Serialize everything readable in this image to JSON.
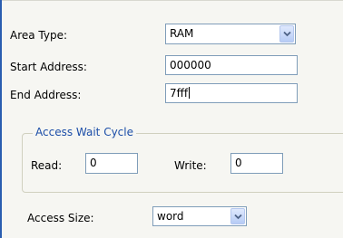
{
  "form": {
    "area_type": {
      "label": "Area Type:",
      "value": "RAM"
    },
    "start_address": {
      "label": "Start Address:",
      "value": "000000"
    },
    "end_address": {
      "label": "End Address:",
      "value": "7fff"
    },
    "access_wait_cycle": {
      "title": "Access Wait Cycle",
      "read_label": "Read:",
      "read_value": "0",
      "write_label": "Write:",
      "write_value": "0"
    },
    "access_size": {
      "label": "Access Size:",
      "value": "word"
    }
  },
  "icons": {
    "dropdown": "chevron-down-icon"
  },
  "colors": {
    "group_title": "#1c4ea8",
    "input_border": "#7f9db9",
    "panel_background": "#f6f6f2",
    "left_accent": "#2a5db0"
  }
}
